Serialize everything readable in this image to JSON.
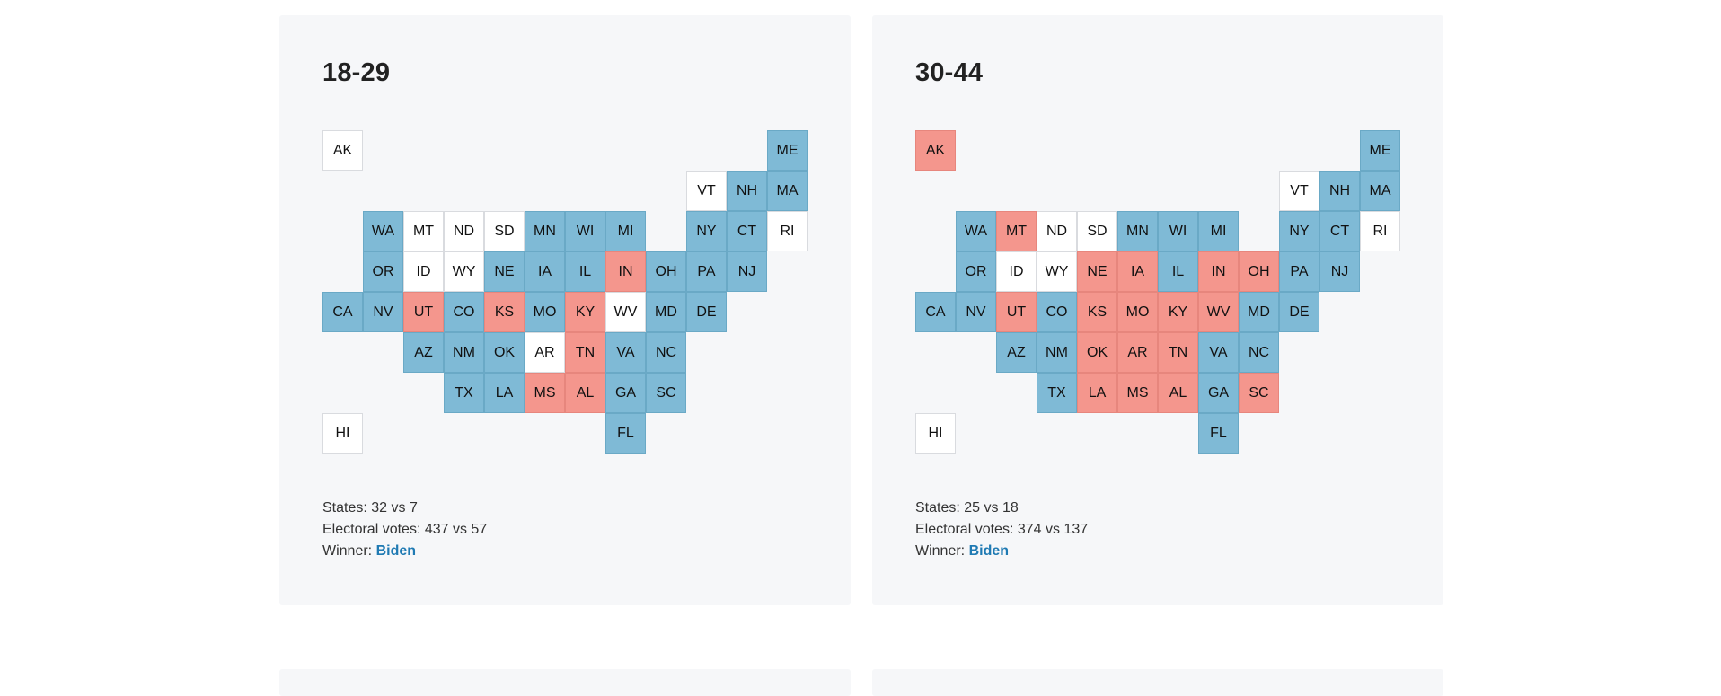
{
  "colors": {
    "biden": "#7fbad6",
    "trump": "#f4968d",
    "tie": "#ffffff",
    "winner_text": "#1f7ab3"
  },
  "labels": {
    "states": "States:",
    "electoral": "Electoral votes:",
    "winner": "Winner:"
  },
  "panels": [
    {
      "title": "18-29",
      "states_text": "32 vs 7",
      "ev_text": "437 vs 57",
      "winner": "Biden",
      "tiles": [
        {
          "st": "AK",
          "w": "N"
        },
        {
          "st": "ME",
          "w": "D"
        },
        {
          "st": "VT",
          "w": "N"
        },
        {
          "st": "NH",
          "w": "D"
        },
        {
          "st": "MA",
          "w": "D"
        },
        {
          "st": "WA",
          "w": "D"
        },
        {
          "st": "MT",
          "w": "N"
        },
        {
          "st": "ND",
          "w": "N"
        },
        {
          "st": "SD",
          "w": "N"
        },
        {
          "st": "MN",
          "w": "D"
        },
        {
          "st": "WI",
          "w": "D"
        },
        {
          "st": "MI",
          "w": "D"
        },
        {
          "st": "NY",
          "w": "D"
        },
        {
          "st": "CT",
          "w": "D"
        },
        {
          "st": "RI",
          "w": "N"
        },
        {
          "st": "OR",
          "w": "D"
        },
        {
          "st": "ID",
          "w": "N"
        },
        {
          "st": "WY",
          "w": "N"
        },
        {
          "st": "NE",
          "w": "D"
        },
        {
          "st": "IA",
          "w": "D"
        },
        {
          "st": "IL",
          "w": "D"
        },
        {
          "st": "IN",
          "w": "R"
        },
        {
          "st": "OH",
          "w": "D"
        },
        {
          "st": "PA",
          "w": "D"
        },
        {
          "st": "NJ",
          "w": "D"
        },
        {
          "st": "CA",
          "w": "D"
        },
        {
          "st": "NV",
          "w": "D"
        },
        {
          "st": "UT",
          "w": "R"
        },
        {
          "st": "CO",
          "w": "D"
        },
        {
          "st": "KS",
          "w": "R"
        },
        {
          "st": "MO",
          "w": "D"
        },
        {
          "st": "KY",
          "w": "R"
        },
        {
          "st": "WV",
          "w": "N"
        },
        {
          "st": "MD",
          "w": "D"
        },
        {
          "st": "DE",
          "w": "D"
        },
        {
          "st": "AZ",
          "w": "D"
        },
        {
          "st": "NM",
          "w": "D"
        },
        {
          "st": "OK",
          "w": "D"
        },
        {
          "st": "AR",
          "w": "N"
        },
        {
          "st": "TN",
          "w": "R"
        },
        {
          "st": "VA",
          "w": "D"
        },
        {
          "st": "NC",
          "w": "D"
        },
        {
          "st": "TX",
          "w": "D"
        },
        {
          "st": "LA",
          "w": "D"
        },
        {
          "st": "MS",
          "w": "R"
        },
        {
          "st": "AL",
          "w": "R"
        },
        {
          "st": "GA",
          "w": "D"
        },
        {
          "st": "SC",
          "w": "D"
        },
        {
          "st": "HI",
          "w": "N"
        },
        {
          "st": "FL",
          "w": "D"
        }
      ]
    },
    {
      "title": "30-44",
      "states_text": "25 vs 18",
      "ev_text": "374 vs 137",
      "winner": "Biden",
      "tiles": [
        {
          "st": "AK",
          "w": "R"
        },
        {
          "st": "ME",
          "w": "D"
        },
        {
          "st": "VT",
          "w": "N"
        },
        {
          "st": "NH",
          "w": "D"
        },
        {
          "st": "MA",
          "w": "D"
        },
        {
          "st": "WA",
          "w": "D"
        },
        {
          "st": "MT",
          "w": "R"
        },
        {
          "st": "ND",
          "w": "N"
        },
        {
          "st": "SD",
          "w": "N"
        },
        {
          "st": "MN",
          "w": "D"
        },
        {
          "st": "WI",
          "w": "D"
        },
        {
          "st": "MI",
          "w": "D"
        },
        {
          "st": "NY",
          "w": "D"
        },
        {
          "st": "CT",
          "w": "D"
        },
        {
          "st": "RI",
          "w": "N"
        },
        {
          "st": "OR",
          "w": "D"
        },
        {
          "st": "ID",
          "w": "N"
        },
        {
          "st": "WY",
          "w": "N"
        },
        {
          "st": "NE",
          "w": "R"
        },
        {
          "st": "IA",
          "w": "R"
        },
        {
          "st": "IL",
          "w": "D"
        },
        {
          "st": "IN",
          "w": "R"
        },
        {
          "st": "OH",
          "w": "R"
        },
        {
          "st": "PA",
          "w": "D"
        },
        {
          "st": "NJ",
          "w": "D"
        },
        {
          "st": "CA",
          "w": "D"
        },
        {
          "st": "NV",
          "w": "D"
        },
        {
          "st": "UT",
          "w": "R"
        },
        {
          "st": "CO",
          "w": "D"
        },
        {
          "st": "KS",
          "w": "R"
        },
        {
          "st": "MO",
          "w": "R"
        },
        {
          "st": "KY",
          "w": "R"
        },
        {
          "st": "WV",
          "w": "R"
        },
        {
          "st": "MD",
          "w": "D"
        },
        {
          "st": "DE",
          "w": "D"
        },
        {
          "st": "AZ",
          "w": "D"
        },
        {
          "st": "NM",
          "w": "D"
        },
        {
          "st": "OK",
          "w": "R"
        },
        {
          "st": "AR",
          "w": "R"
        },
        {
          "st": "TN",
          "w": "R"
        },
        {
          "st": "VA",
          "w": "D"
        },
        {
          "st": "NC",
          "w": "D"
        },
        {
          "st": "TX",
          "w": "D"
        },
        {
          "st": "LA",
          "w": "R"
        },
        {
          "st": "MS",
          "w": "R"
        },
        {
          "st": "AL",
          "w": "R"
        },
        {
          "st": "GA",
          "w": "D"
        },
        {
          "st": "SC",
          "w": "R"
        },
        {
          "st": "HI",
          "w": "N"
        },
        {
          "st": "FL",
          "w": "D"
        }
      ]
    }
  ]
}
